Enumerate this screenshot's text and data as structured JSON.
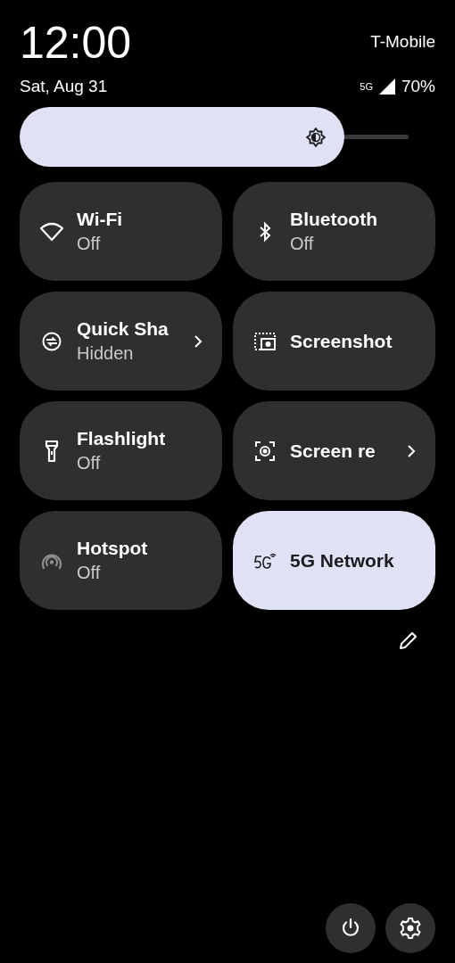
{
  "header": {
    "time": "12:00",
    "date": "Sat, Aug 31",
    "carrier": "T-Mobile",
    "network_type": "5G",
    "battery": "70%"
  },
  "brightness": {
    "level": 0.745
  },
  "tiles": [
    {
      "kind": "wifi",
      "label": "Wi-Fi",
      "status": "Off",
      "on": false,
      "disabled": false,
      "chevron": false
    },
    {
      "kind": "bluetooth",
      "label": "Bluetooth",
      "status": "Off",
      "on": false,
      "disabled": false,
      "chevron": false
    },
    {
      "kind": "share",
      "label": "Quick Sha",
      "status": "Hidden",
      "on": false,
      "disabled": false,
      "chevron": true
    },
    {
      "kind": "screenshot",
      "label": "Screenshot",
      "on": false,
      "disabled": false,
      "chevron": false
    },
    {
      "kind": "flashlight",
      "label": "Flashlight",
      "status": "Off",
      "on": false,
      "disabled": false,
      "chevron": false
    },
    {
      "kind": "record",
      "label": "Screen re",
      "on": false,
      "disabled": false,
      "chevron": true
    },
    {
      "kind": "hotspot",
      "label": "Hotspot",
      "status": "Off",
      "on": false,
      "disabled": true,
      "chevron": false
    },
    {
      "kind": "network",
      "label": "5G Network",
      "on": true,
      "disabled": false,
      "chevron": false
    }
  ]
}
